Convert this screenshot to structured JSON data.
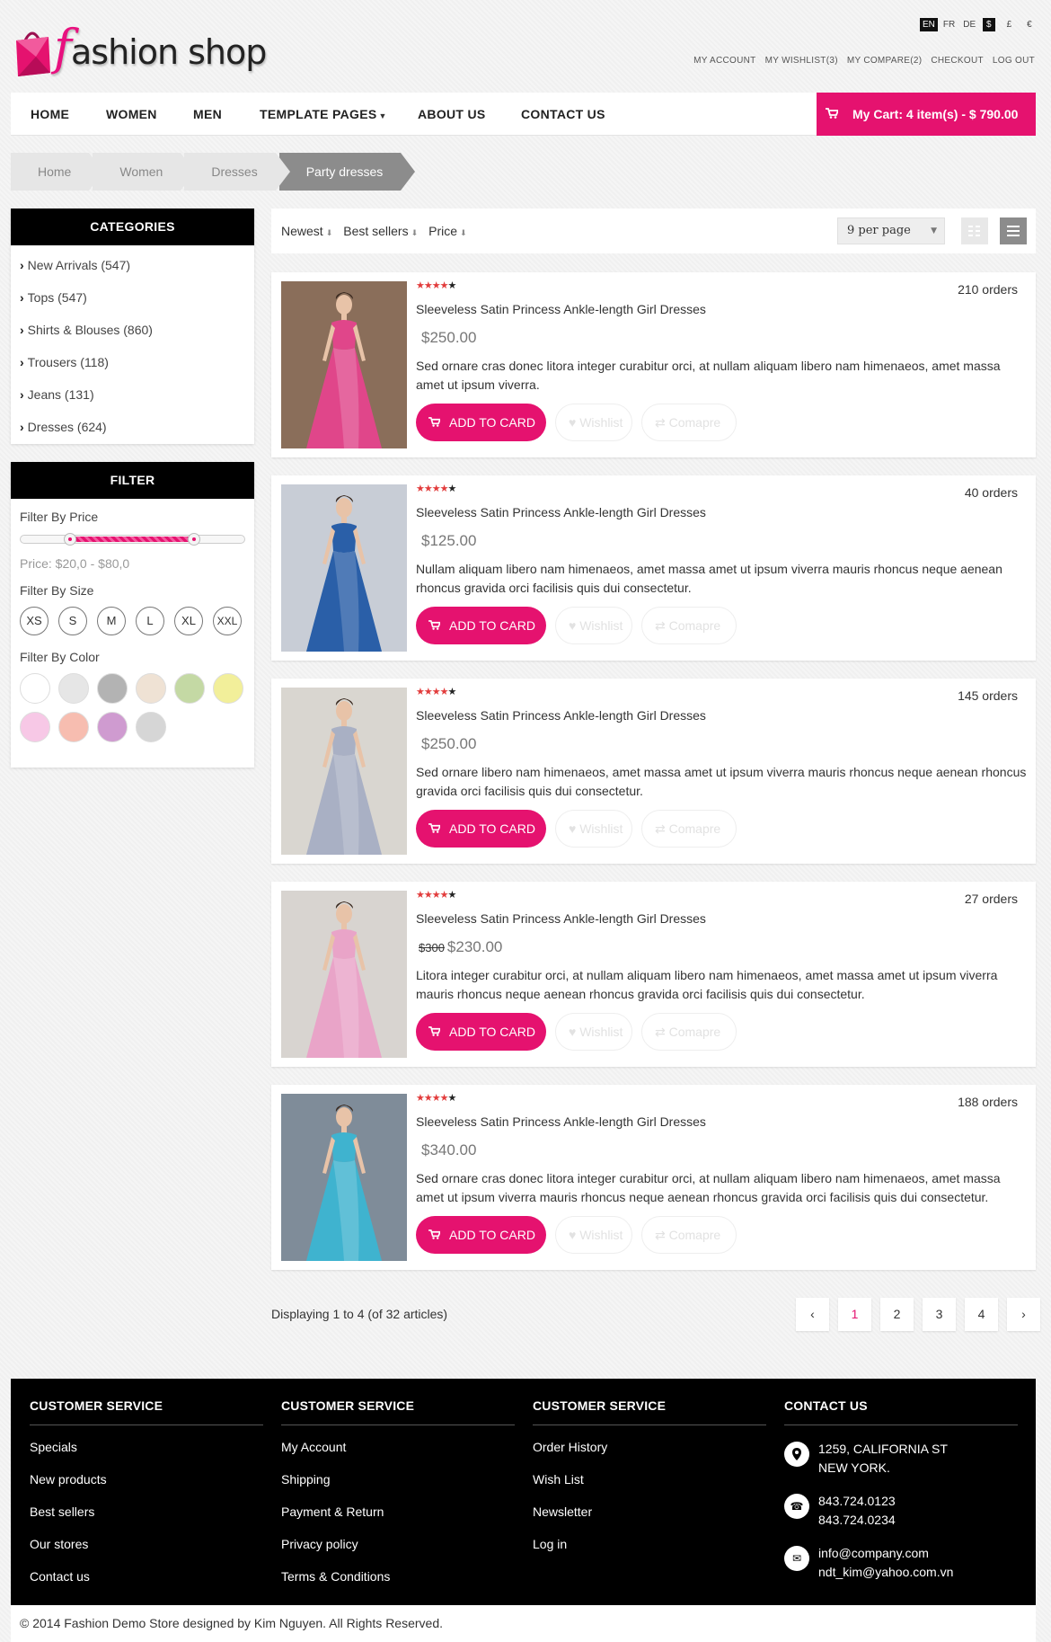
{
  "header": {
    "logo_letter": "f",
    "logo_text": "ashion shop",
    "languages": [
      "EN",
      "FR",
      "DE"
    ],
    "active_language": "EN",
    "currencies": [
      "$",
      "£",
      "€"
    ],
    "active_currency": "$",
    "top_links": [
      "MY ACCOUNT",
      "MY WISHLIST(3)",
      "MY COMPARE(2)",
      "CHECKOUT",
      "LOG OUT"
    ]
  },
  "nav": {
    "items": [
      "HOME",
      "WOMEN",
      "MEN",
      "TEMPLATE PAGES",
      "ABOUT US",
      "CONTACT US"
    ],
    "cart_label": "My Cart: 4 item(s) - $ 790.00"
  },
  "breadcrumb": [
    "Home",
    "Women",
    "Dresses",
    "Party dresses"
  ],
  "categories": {
    "title": "CATEGORIES",
    "items": [
      "New Arrivals (547)",
      "Tops (547)",
      "Shirts & Blouses (860)",
      "Trousers (118)",
      "Jeans (131)",
      "Dresses (624)"
    ]
  },
  "filter": {
    "title": "FILTER",
    "price_label": "Filter By Price",
    "price_range": "Price: $20,0 - $80,0",
    "size_label": "Filter By Size",
    "sizes": [
      "XS",
      "S",
      "M",
      "L",
      "XL",
      "XXL"
    ],
    "color_label": "Filter By Color",
    "colors": [
      "#ffffff",
      "#e6e6e6",
      "#b3b3b3",
      "#efe2d4",
      "#c4d9a4",
      "#f2ef9a",
      "#f7c8e6",
      "#f7bdb0",
      "#cf9bd0",
      "#d6d6d6"
    ]
  },
  "toolbar": {
    "sorts": [
      "Newest",
      "Best sellers",
      "Price"
    ],
    "per_page": "9 per page"
  },
  "products": [
    {
      "name": "Sleeveless Satin Princess Ankle-length Girl Dresses",
      "orders": "210 orders",
      "old_price": "",
      "price": "$250.00",
      "desc": "Sed ornare cras donec litora integer curabitur orci, at nullam aliquam libero nam himenaeos, amet massa amet ut ipsum viverra.",
      "dress_color": "#e0468a",
      "bg_color": "#8a6e5a"
    },
    {
      "name": "Sleeveless Satin Princess Ankle-length Girl Dresses",
      "orders": "40 orders",
      "old_price": "",
      "price": "$125.00",
      "desc": "Nullam aliquam libero nam himenaeos, amet massa amet ut ipsum viverra mauris rhoncus neque aenean rhoncus gravida orci facilisis quis dui consectetur.",
      "dress_color": "#2a5fa8",
      "bg_color": "#c8cdd6"
    },
    {
      "name": "Sleeveless Satin Princess Ankle-length Girl Dresses",
      "orders": "145 orders",
      "old_price": "",
      "price": "$250.00",
      "desc": "Sed ornare libero nam himenaeos, amet massa amet ut ipsum viverra mauris rhoncus neque aenean rhoncus gravida orci facilisis quis dui consectetur.",
      "dress_color": "#a9b0c4",
      "bg_color": "#d9d6d0"
    },
    {
      "name": "Sleeveless Satin Princess Ankle-length Girl Dresses",
      "orders": "27 orders",
      "old_price": "$300",
      "price": "$230.00",
      "desc": "Litora integer curabitur orci, at nullam aliquam libero nam himenaeos, amet massa amet ut ipsum viverra mauris rhoncus neque aenean rhoncus gravida orci facilisis quis dui consectetur.",
      "dress_color": "#e9a4c8",
      "bg_color": "#d8d4d0"
    },
    {
      "name": "Sleeveless Satin Princess Ankle-length Girl Dresses",
      "orders": "188 orders",
      "old_price": "",
      "price": "$340.00",
      "desc": "Sed ornare cras donec litora integer curabitur orci, at nullam aliquam libero nam himenaeos, amet massa amet ut ipsum viverra mauris rhoncus neque aenean rhoncus gravida orci facilisis quis dui consectetur.",
      "dress_color": "#3fb3cf",
      "bg_color": "#7f8c99"
    }
  ],
  "product_buttons": {
    "add_to_cart": "ADD TO CARD",
    "wishlist": "Wishlist",
    "compare": "Comapre"
  },
  "pagination": {
    "summary": "Displaying 1 to 4 (of 32 articles)",
    "prev": "‹",
    "pages": [
      "1",
      "2",
      "3",
      "4"
    ],
    "active_page": "1",
    "next": "›"
  },
  "footer": {
    "col1": {
      "title": "CUSTOMER SERVICE",
      "links": [
        "Specials",
        "New products",
        "Best sellers",
        "Our stores",
        "Contact us"
      ]
    },
    "col2": {
      "title": "CUSTOMER SERVICE",
      "links": [
        "My Account",
        "Shipping",
        "Payment & Return",
        "Privacy policy",
        "Terms & Conditions"
      ]
    },
    "col3": {
      "title": "CUSTOMER SERVICE",
      "links": [
        "Order History",
        "Wish List",
        "Newsletter",
        "Log in"
      ]
    },
    "contact": {
      "title": "CONTACT US",
      "address_line1": "1259, CALIFORNIA ST",
      "address_line2": "NEW YORK.",
      "phone1": "843.724.0123",
      "phone2": "843.724.0234",
      "email1": "info@company.com",
      "email2": "ndt_kim@yahoo.com.vn"
    },
    "copyright": "© 2014 Fashion Demo Store designed by Kim Nguyen. All Rights Reserved."
  },
  "colors": {
    "accent": "#e5126f",
    "dark": "#000000"
  }
}
